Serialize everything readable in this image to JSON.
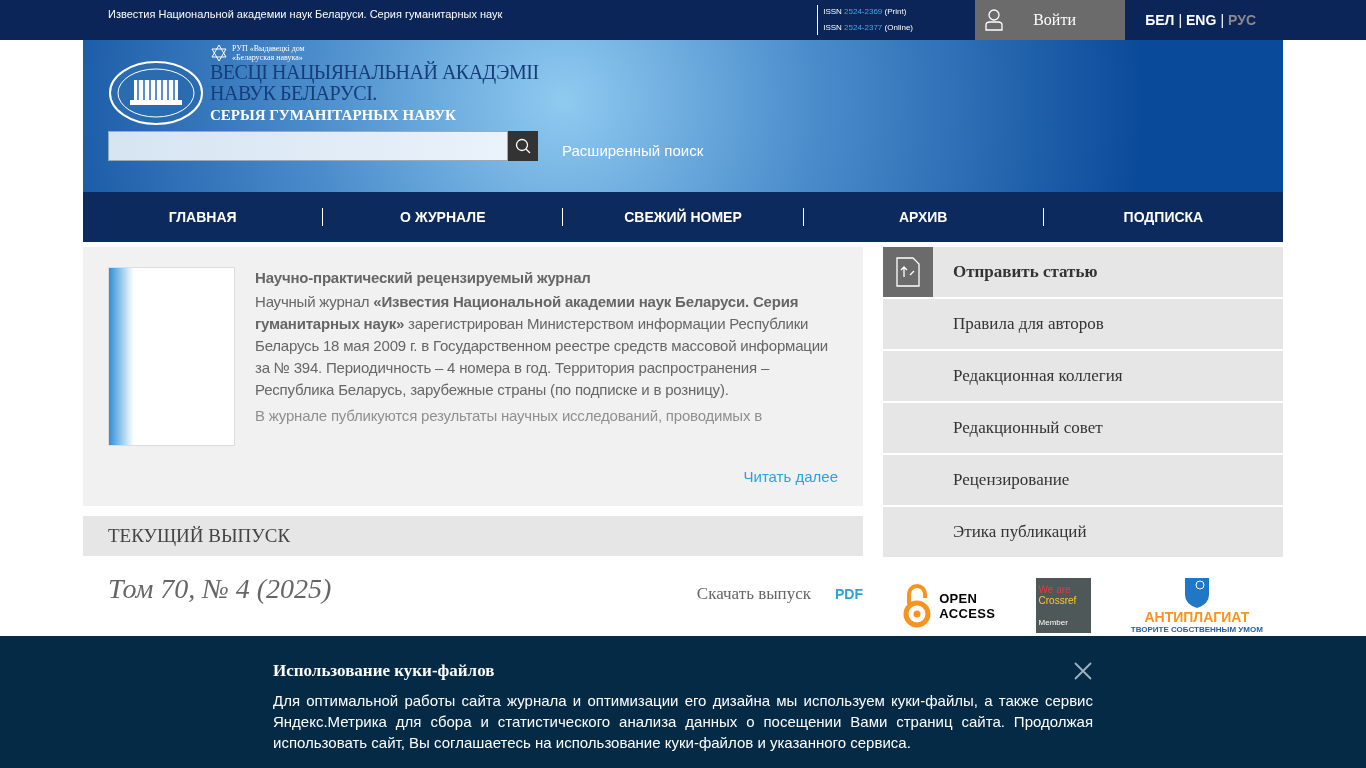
{
  "top_bar": {
    "title": "Известия Национальной академии наук Беларуси. Серия гуманитарных наук",
    "issn": [
      {
        "prefix": "ISSN",
        "number": "2524-2369",
        "note": "(Print)"
      },
      {
        "prefix": "ISSN",
        "number": "2524-2377",
        "note": "(Online)"
      }
    ],
    "login": "Войти",
    "separator": "|",
    "languages": [
      {
        "label": "БЕЛ",
        "selected": false
      },
      {
        "label": "ENG",
        "selected": false
      },
      {
        "label": "РУС",
        "selected": true
      }
    ]
  },
  "header": {
    "publisher": [
      "РУП «Выдавецкі дом",
      "«Беларуская навука»"
    ],
    "logo_lines": [
      "ВЕСЦІ НАЦЫЯНАЛЬНАЙ АКАДЭМІІ",
      "НАВУК БЕЛАРУСІ."
    ],
    "logo_series": "СЕРЫЯ ГУМАНІТАРНЫХ НАВУК",
    "advanced_search": "Расширенный поиск"
  },
  "nav": [
    {
      "label": "ГЛАВНАЯ"
    },
    {
      "label": "О ЖУРНАЛЕ"
    },
    {
      "label": "СВЕЖИЙ НОМЕР"
    },
    {
      "label": "АРХИВ"
    },
    {
      "label": "ПОДПИСКА"
    }
  ],
  "about": {
    "heading": "Научно-практический рецензируемый журнал",
    "paragraphs": [
      "Научный журнал **«Известия Национальной  академии наук Беларуси. Серия гуманитарных наук»** зарегистрирован Министерством информации Республики Беларусь 18 мая 2009 г. в Государственном реестре средств массовой информации за № 394. Периодичность – 4 номера в год. Территория распространения – Республика Беларусь, зарубежные страны (по подписке и в розницу).",
      "В журнале публикуются результаты научных исследований, проводимых в"
    ],
    "read_more": "Читать далее"
  },
  "current_issue": {
    "heading": "ТЕКУЩИЙ ВЫПУСК",
    "volume": "Том 70, № 4 (2025)",
    "download": "Скачать выпуск",
    "format": "PDF"
  },
  "sidebar": [
    {
      "label": "Отправить статью",
      "kind": "primary"
    },
    {
      "label": "Правила для авторов",
      "kind": "link"
    },
    {
      "label": "Редакционная коллегия",
      "kind": "link"
    },
    {
      "label": "Редакционный совет",
      "kind": "link"
    },
    {
      "label": "Рецензирование",
      "kind": "link"
    },
    {
      "label": "Этика публикаций",
      "kind": "link"
    }
  ],
  "badges": [
    {
      "kind": "open_access",
      "lines": [
        "OPEN",
        "ACCESS"
      ]
    },
    {
      "kind": "crossref",
      "lines": [
        "We are",
        "Crossref",
        "Member"
      ]
    },
    {
      "kind": "antiplagiat",
      "lines": [
        "АНТИПЛАГИАТ",
        "ТВОРИТЕ СОБСТВЕННЫМ УМОМ"
      ]
    }
  ],
  "cookie": {
    "title": "Использование куки-файлов",
    "text": "Для оптимальной работы сайта журнала и оптимизации его дизайна мы используем куки-файлы, а также сервис Яндекс.Метрика для сбора и статистического анализа данных о посещении Вами страниц сайта. Продолжая использовать сайт, Вы соглашаетесь на использование куки-файлов и указанного сервиса."
  }
}
